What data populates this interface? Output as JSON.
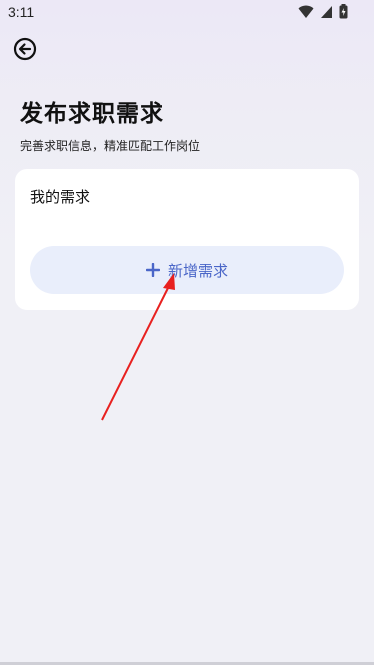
{
  "status_bar": {
    "time": "3:11"
  },
  "header": {
    "title": "发布求职需求",
    "subtitle": "完善求职信息，精准匹配工作岗位"
  },
  "card": {
    "label": "我的需求",
    "add_button_label": "新增需求"
  },
  "colors": {
    "accent": "#4a66c8",
    "annotation_arrow": "#e8201f"
  }
}
